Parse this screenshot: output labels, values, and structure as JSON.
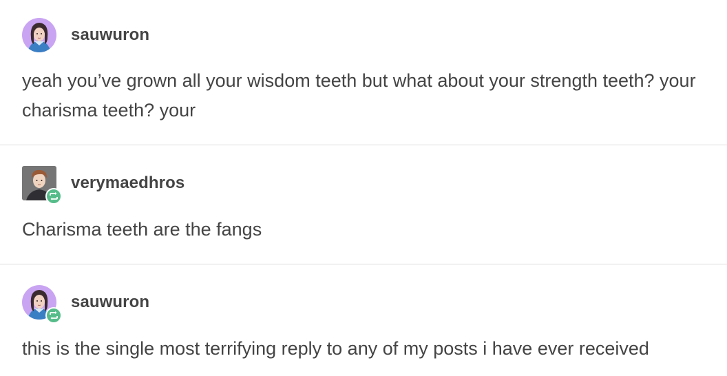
{
  "posts": [
    {
      "username": "sauwuron",
      "avatar": "sauwuron-avatar",
      "reblog": false,
      "text": "yeah you’ve grown all your wisdom teeth but what about your strength teeth? your charisma teeth? your"
    },
    {
      "username": "verymaedhros",
      "avatar": "verymaedhros-avatar",
      "reblog": true,
      "text": "Charisma teeth are the fangs"
    },
    {
      "username": "sauwuron",
      "avatar": "sauwuron-avatar",
      "reblog": true,
      "text": "this is the single most terrifying reply to any of my posts i have ever received"
    }
  ],
  "colors": {
    "text": "#444444",
    "divider": "#dcdcdc",
    "reblog_badge": "#56bc8a",
    "avatar_bg_purple": "#c9a4f2"
  },
  "icons": {
    "reblog": "reblog-icon"
  }
}
